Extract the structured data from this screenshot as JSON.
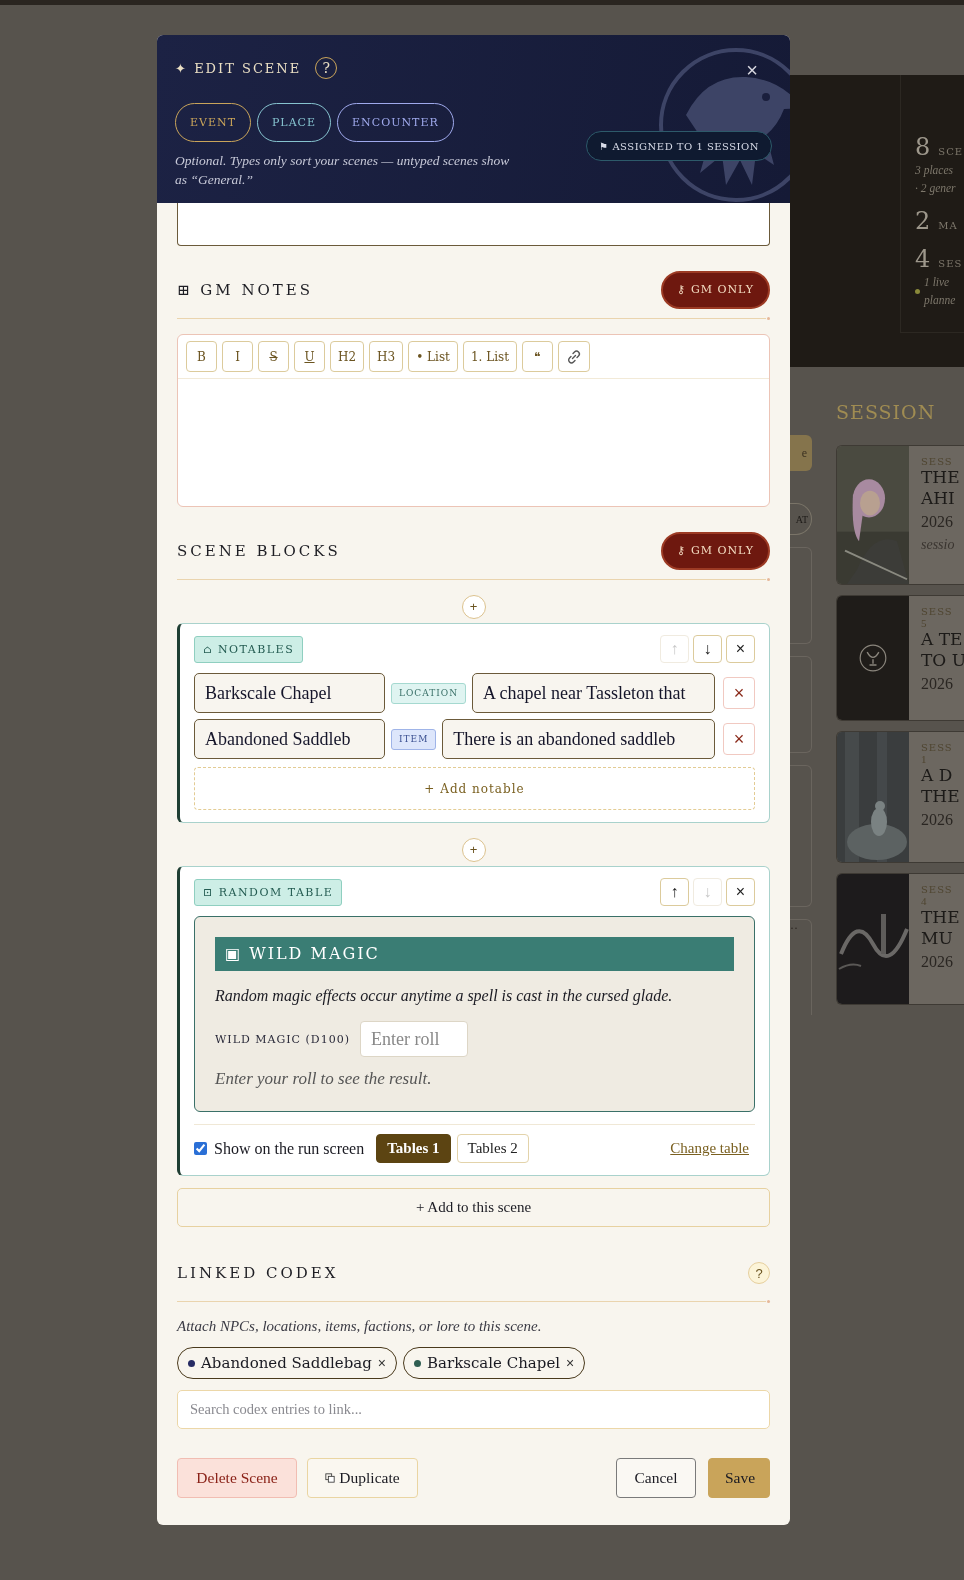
{
  "background": {
    "stats": [
      {
        "kind": "plain",
        "number": "8",
        "label": "SCE",
        "lines": [
          "3 places",
          "· 2 gener"
        ]
      },
      {
        "kind": "plain",
        "number": "2",
        "label": "MA"
      },
      {
        "kind": "live",
        "number": "4",
        "label": "SES",
        "lines": [
          "1 live",
          "planne"
        ]
      }
    ],
    "strip": {
      "button": "e",
      "pill": "AT",
      "more": "··"
    },
    "sessions": {
      "heading": "SESSION",
      "cards": [
        {
          "kind": "portrait",
          "label": "SESS",
          "title_lines": [
            "THE",
            "AHI"
          ],
          "date": "2026",
          "note": "sessio"
        },
        {
          "kind": "emblem",
          "label": "SESS",
          "number": "5",
          "title_lines": [
            "A TE",
            "TO U"
          ],
          "date": "2026"
        },
        {
          "kind": "mist",
          "label": "SESS",
          "number": "1",
          "title_lines": [
            "A D",
            "THE"
          ],
          "date": "2026"
        },
        {
          "kind": "dark",
          "label": "SESS",
          "number": "4",
          "title_lines": [
            "THE",
            "MU"
          ],
          "date": "2026"
        }
      ]
    }
  },
  "dialog": {
    "title": "✦ EDIT SCENE",
    "help": "?",
    "close": "×",
    "types": [
      {
        "label": "EVENT",
        "color": "#c9a45a"
      },
      {
        "label": "PLACE",
        "color": "#86c3cf"
      },
      {
        "label": "ENCOUNTER",
        "color": "#9fa9ec"
      }
    ],
    "types_hint": "Optional. Types only sort your scenes — untyped scenes show as “General.”",
    "assigned": "⚑ ASSIGNED TO 1 SESSION"
  },
  "gm_notes": {
    "heading": "⊞ GM NOTES",
    "badge": "⚷ GM ONLY",
    "toolbar": [
      {
        "kind": "bold",
        "label": "B"
      },
      {
        "kind": "italic",
        "label": "I"
      },
      {
        "kind": "strike",
        "label": "S"
      },
      {
        "kind": "underline",
        "label": "U"
      },
      {
        "kind": "text",
        "label": "H2"
      },
      {
        "kind": "text",
        "label": "H3"
      },
      {
        "kind": "text",
        "label": "• List"
      },
      {
        "kind": "text",
        "label": "1. List"
      },
      {
        "kind": "text",
        "label": "❝"
      },
      {
        "kind": "link"
      }
    ]
  },
  "scene_blocks": {
    "heading": "SCENE BLOCKS",
    "badge": "⚷ GM ONLY",
    "blocks": [
      {
        "kind": "notables",
        "insert": "+",
        "badge": "⌂ NOTABLES",
        "controls": [
          {
            "label": "↑",
            "disabled": true
          },
          {
            "label": "↓",
            "disabled": false
          },
          {
            "label": "×",
            "disabled": false
          }
        ],
        "rows": [
          {
            "name": "Barkscale Chapel",
            "type": "LOCATION",
            "kind": "location",
            "description": "A chapel near Tassleton that",
            "remove": "×"
          },
          {
            "name": "Abandoned Saddleb",
            "type": "ITEM",
            "kind": "item",
            "description": "There is an abandoned saddleb",
            "remove": "×"
          }
        ],
        "add": "+ Add notable"
      },
      {
        "kind": "random_table",
        "insert": "+",
        "badge": "⊡ RANDOM TABLE",
        "controls": [
          {
            "label": "↑",
            "disabled": false
          },
          {
            "label": "↓",
            "disabled": true
          },
          {
            "label": "×",
            "disabled": false
          }
        ],
        "table": {
          "title": "▣ WILD MAGIC",
          "description": "Random magic effects occur anytime a spell is cast in the cursed glade.",
          "roll_label": "WILD MAGIC (D100)",
          "roll_placeholder": "Enter roll",
          "result": "Enter your roll to see the result."
        },
        "show_on_run": {
          "label": "Show on the run screen",
          "checked": true
        },
        "tabs": [
          {
            "label": "Tables 1",
            "selected": true
          },
          {
            "label": "Tables 2",
            "selected": false
          }
        ],
        "change": "Change table"
      }
    ],
    "add_to_scene": "+ Add to this scene"
  },
  "codex": {
    "heading": "LINKED CODEX",
    "help": "?",
    "hint": "Attach NPCs, locations, items, factions, or lore to this scene.",
    "chips": [
      {
        "label": "Abandoned Saddlebag",
        "color": "#262b63",
        "remove": "×"
      },
      {
        "label": "Barkscale Chapel",
        "color": "#2f5e52",
        "remove": "×"
      }
    ],
    "search_placeholder": "Search codex entries to link..."
  },
  "footer": {
    "delete": "Delete Scene",
    "duplicate": "Duplicate",
    "cancel": "Cancel",
    "save": "Save"
  }
}
